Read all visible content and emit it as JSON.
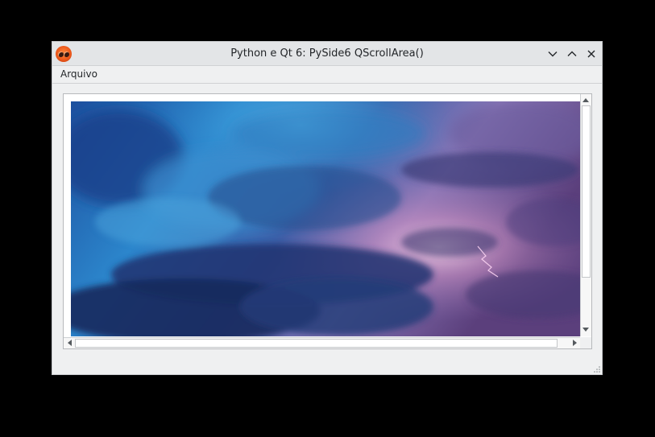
{
  "window": {
    "title": "Python e Qt 6: PySide6 QScrollArea()",
    "app_icon": "pyside-logo-icon",
    "controls": [
      "minimize-chevron-icon",
      "maximize-chevron-icon",
      "close-x-icon"
    ]
  },
  "menubar": {
    "items": [
      {
        "label": "Arquivo"
      }
    ]
  },
  "scroll_area": {
    "content": "storm-clouds-lightning-image",
    "vertical_scrollbar_position": 0.0,
    "horizontal_scrollbar_position": 0.0
  },
  "colors": {
    "window_bg": "#eff0f1",
    "titlebar_bg": "#e3e5e7",
    "text": "#232629",
    "desktop": "#000000"
  }
}
